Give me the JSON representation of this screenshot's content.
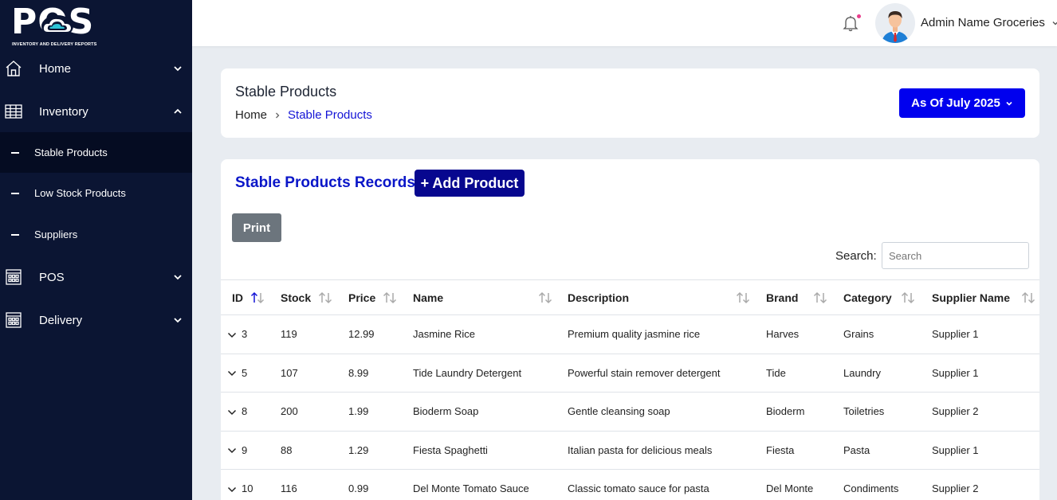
{
  "brand": {
    "logo_text": "POS",
    "logo_subtitle": "INVENTORY AND DELIVERY REPORTS"
  },
  "sidebar": {
    "items": [
      {
        "label": "Home",
        "icon": "home-icon",
        "expanded": false
      },
      {
        "label": "Inventory",
        "icon": "grid-icon",
        "expanded": true
      },
      {
        "label": "POS",
        "icon": "building-icon",
        "expanded": false
      },
      {
        "label": "Delivery",
        "icon": "building-icon",
        "expanded": false
      }
    ],
    "subitems": [
      {
        "label": "Stable Products",
        "active": true
      },
      {
        "label": "Low Stock Products",
        "active": false
      },
      {
        "label": "Suppliers",
        "active": false
      }
    ]
  },
  "header": {
    "user_name": "Admin Name Groceries",
    "notification_dot_color": "#e83e8c"
  },
  "page": {
    "title": "Stable Products",
    "breadcrumb": {
      "home": "Home",
      "current": "Stable Products"
    },
    "period_button": "As Of July 2025"
  },
  "records": {
    "title": "Stable Products Records",
    "add_button": "+ Add Product",
    "print_button": "Print",
    "search_label": "Search:",
    "search_placeholder": "Search",
    "columns": [
      "ID",
      "Stock",
      "Price",
      "Name",
      "Description",
      "Brand",
      "Category",
      "Supplier Name"
    ],
    "sorted_column": "ID",
    "rows": [
      {
        "id": "3",
        "stock": "119",
        "price": "12.99",
        "name": "Jasmine Rice",
        "description": "Premium quality jasmine rice",
        "brand": "Harves",
        "category": "Grains",
        "supplier": "Supplier 1"
      },
      {
        "id": "5",
        "stock": "107",
        "price": "8.99",
        "name": "Tide Laundry Detergent",
        "description": "Powerful stain remover detergent",
        "brand": "Tide",
        "category": "Laundry",
        "supplier": "Supplier 1"
      },
      {
        "id": "8",
        "stock": "200",
        "price": "1.99",
        "name": "Bioderm Soap",
        "description": "Gentle cleansing soap",
        "brand": "Bioderm",
        "category": "Toiletries",
        "supplier": "Supplier 2"
      },
      {
        "id": "9",
        "stock": "88",
        "price": "1.29",
        "name": "Fiesta Spaghetti",
        "description": "Italian pasta for delicious meals",
        "brand": "Fiesta",
        "category": "Pasta",
        "supplier": "Supplier 1"
      },
      {
        "id": "10",
        "stock": "116",
        "price": "0.99",
        "name": "Del Monte Tomato Sauce",
        "description": "Classic tomato sauce for pasta",
        "brand": "Del Monte",
        "category": "Condiments",
        "supplier": "Supplier 2"
      }
    ]
  },
  "colors": {
    "sidebar_bg": "#0b1533",
    "accent_blue": "#0000ee",
    "add_button": "#07078f",
    "title_blue": "#0a16c8"
  }
}
